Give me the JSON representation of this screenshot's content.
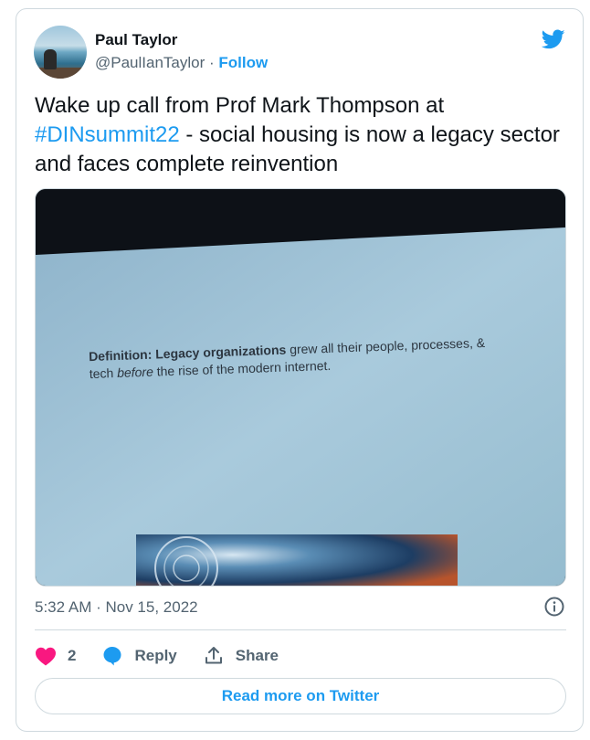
{
  "author": {
    "name": "Paul Taylor",
    "handle": "@PaulIanTaylor",
    "separator": " · ",
    "follow_label": "Follow"
  },
  "tweet": {
    "text_before": "Wake up call from Prof Mark Thompson at ",
    "hashtag": "#DINsummit22",
    "text_after": " - social housing is now a legacy sector and faces complete reinvention",
    "timestamp": "5:32 AM · Nov 15, 2022"
  },
  "media": {
    "slide_bold": "Definition: Legacy organizations",
    "slide_line1_rest": " grew all their people, processes, &",
    "slide_line2_a": "tech ",
    "slide_line2_italic": "before",
    "slide_line2_b": " the rise of the modern internet."
  },
  "actions": {
    "like_count": "2",
    "reply_label": "Reply",
    "share_label": "Share"
  },
  "read_more_label": "Read more on Twitter",
  "icons": {
    "brand": "twitter-bird-icon",
    "info": "info-icon",
    "like": "heart-icon",
    "reply": "reply-bubble-icon",
    "share": "share-upload-icon"
  },
  "colors": {
    "accent": "#1d9bf0",
    "like": "#f91880",
    "secondary_text": "#536471",
    "border": "#cfd9de"
  }
}
